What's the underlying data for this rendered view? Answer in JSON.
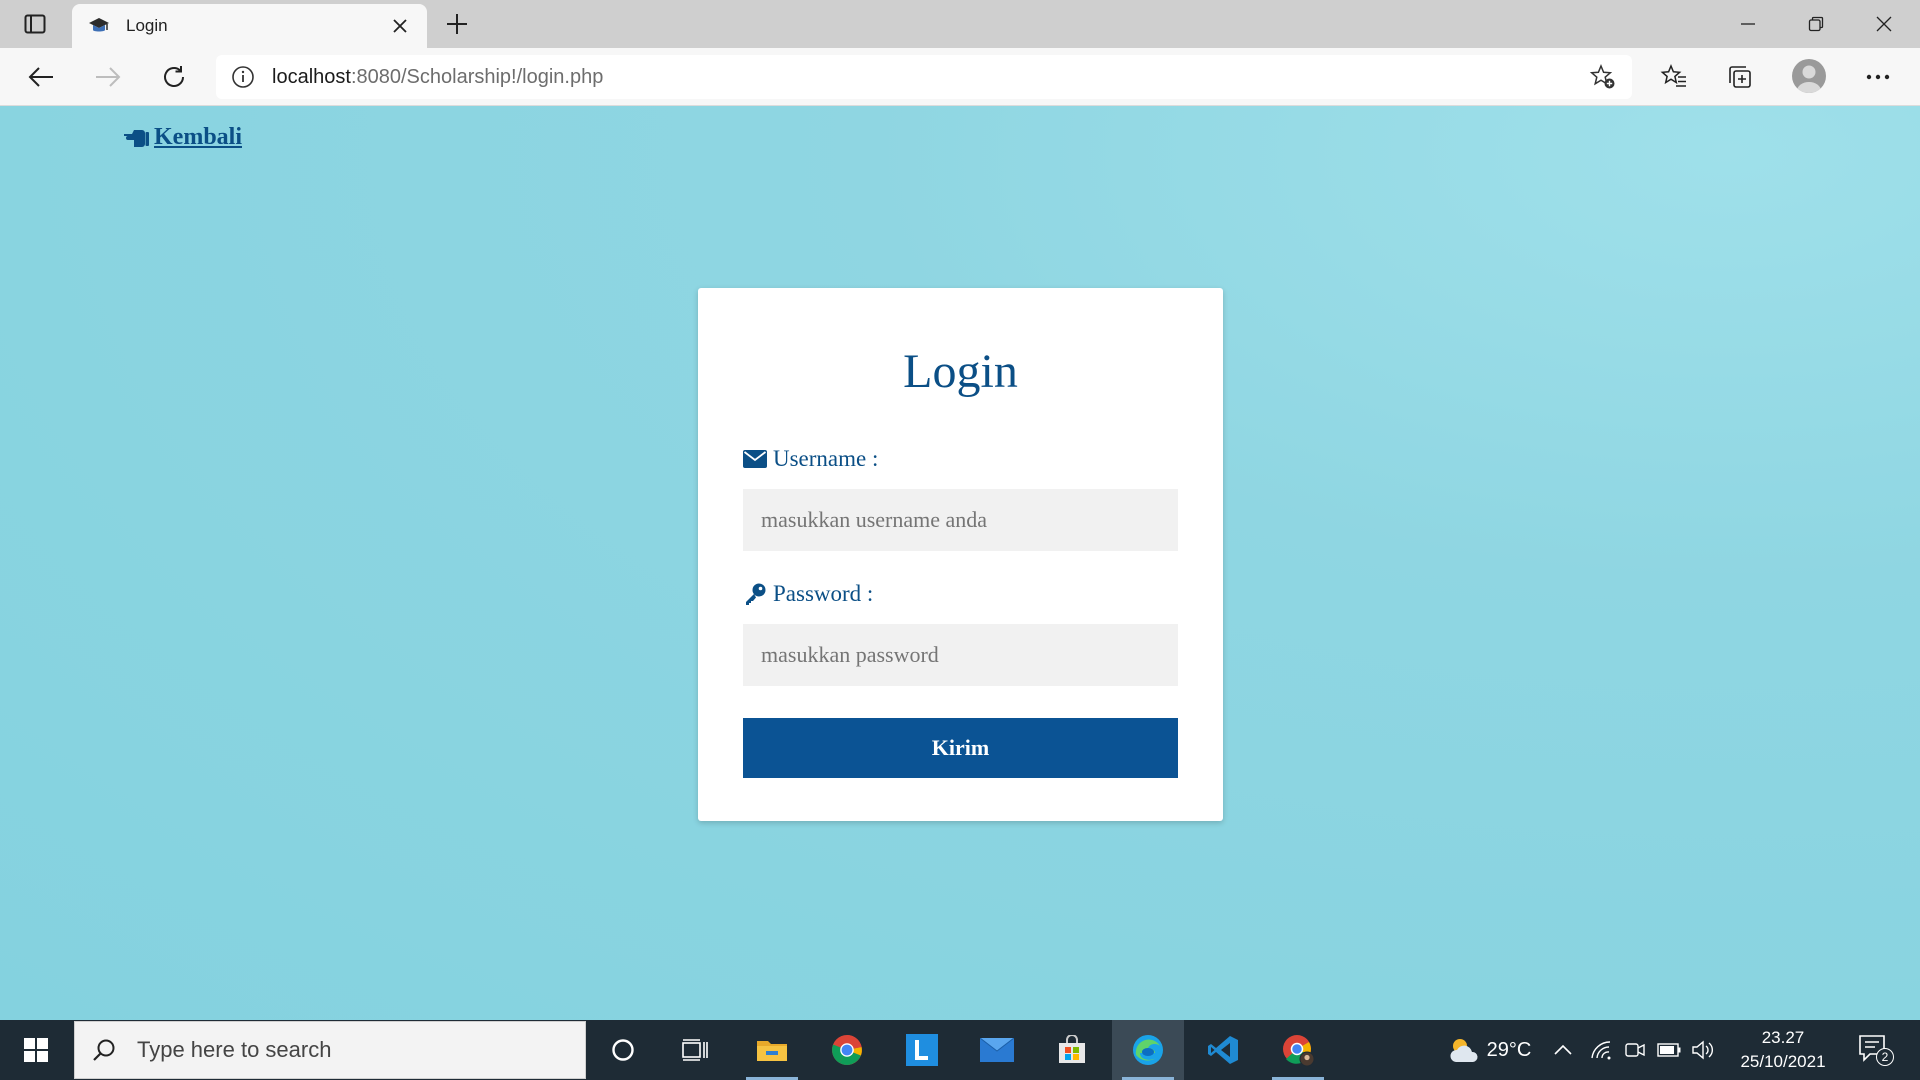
{
  "browser": {
    "tab": {
      "title": "Login"
    },
    "address": {
      "host": "localhost",
      "path": ":8080/Scholarship!/login.php"
    }
  },
  "page": {
    "back_link": "Kembali",
    "form": {
      "title": "Login",
      "username": {
        "label": "Username :",
        "placeholder": "masukkan username anda"
      },
      "password": {
        "label": "Password :",
        "placeholder": "masukkan password"
      },
      "submit": "Kirim"
    },
    "colors": {
      "background": "#8fd6e2",
      "accent": "#0b5394",
      "text": "#0b4f86"
    }
  },
  "taskbar": {
    "search_placeholder": "Type here to search",
    "weather": {
      "temp": "29°C"
    },
    "clock": {
      "time": "23.27",
      "date": "25/10/2021"
    },
    "notifications": {
      "count": "2"
    },
    "pinned": [
      "cortana-icon",
      "task-view-icon",
      "file-explorer-icon",
      "chrome-icon",
      "l-app-icon",
      "mail-icon",
      "store-icon",
      "edge-icon",
      "vscode-icon",
      "chrome-profile-icon"
    ]
  }
}
